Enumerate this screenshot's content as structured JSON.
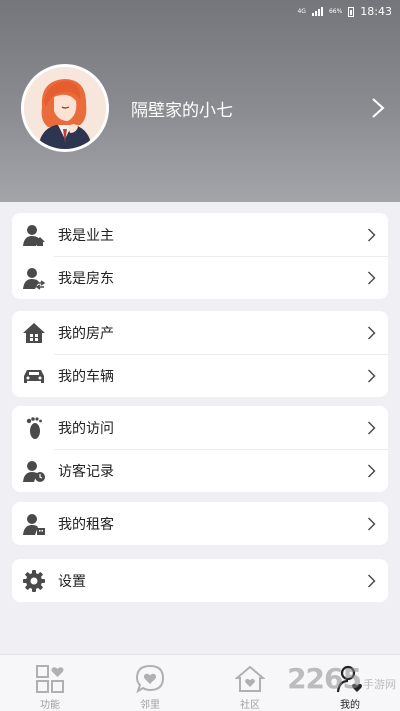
{
  "status_bar": {
    "network": "4G",
    "battery": "66%",
    "time": "18:43"
  },
  "profile": {
    "username": "隔壁家的小七"
  },
  "menu_groups": [
    [
      {
        "label": "我是业主",
        "icon": "owner-icon"
      },
      {
        "label": "我是房东",
        "icon": "landlord-icon"
      }
    ],
    [
      {
        "label": "我的房产",
        "icon": "house-icon"
      },
      {
        "label": "我的车辆",
        "icon": "car-icon"
      }
    ],
    [
      {
        "label": "我的访问",
        "icon": "footprint-icon"
      },
      {
        "label": "访客记录",
        "icon": "visitor-clock-icon"
      }
    ],
    [
      {
        "label": "我的租客",
        "icon": "tenant-icon"
      }
    ],
    [
      {
        "label": "设置",
        "icon": "gear-icon"
      }
    ]
  ],
  "tabbar": {
    "tabs": [
      {
        "label": "功能",
        "icon": "grid-heart-icon"
      },
      {
        "label": "邻里",
        "icon": "chat-heart-icon"
      },
      {
        "label": "社区",
        "icon": "community-house-icon"
      },
      {
        "label": "我的",
        "icon": "person-heart-icon",
        "active": true
      }
    ]
  },
  "watermark": {
    "number": "2265",
    "site": "手游网"
  },
  "colors": {
    "header": "#84868b",
    "icon": "#4a4a4a",
    "background": "#efeff4"
  }
}
